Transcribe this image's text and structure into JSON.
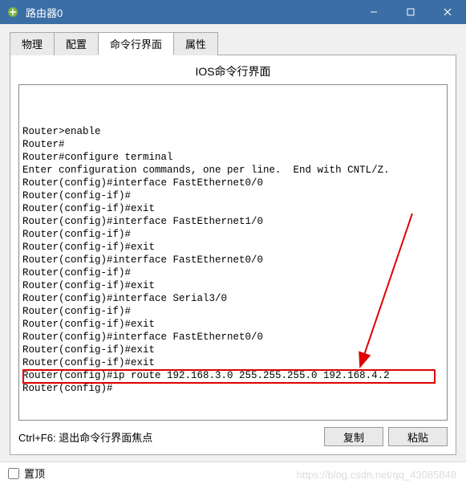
{
  "titlebar": {
    "title": "路由器0"
  },
  "tabs": {
    "items": [
      {
        "label": "物理"
      },
      {
        "label": "配置"
      },
      {
        "label": "命令行界面"
      },
      {
        "label": "属性"
      }
    ],
    "active_index": 2
  },
  "pane": {
    "title": "IOS命令行界面"
  },
  "terminal": {
    "lines": [
      "",
      "",
      "",
      "Router>enable",
      "Router#",
      "Router#configure terminal",
      "Enter configuration commands, one per line.  End with CNTL/Z.",
      "Router(config)#interface FastEthernet0/0",
      "Router(config-if)#",
      "Router(config-if)#exit",
      "Router(config)#interface FastEthernet1/0",
      "Router(config-if)#",
      "Router(config-if)#exit",
      "Router(config)#interface FastEthernet0/0",
      "Router(config-if)#",
      "Router(config-if)#exit",
      "Router(config)#interface Serial3/0",
      "Router(config-if)#",
      "Router(config-if)#exit",
      "Router(config)#interface FastEthernet0/0",
      "Router(config-if)#exit",
      "Router(config-if)#exit",
      "Router(config)#ip route 192.168.3.0 255.255.255.0 192.168.4.2",
      "Router(config)#"
    ],
    "highlighted_line_index": 22
  },
  "hint": {
    "text": "Ctrl+F6: 退出命令行界面焦点"
  },
  "buttons": {
    "copy": "复制",
    "paste": "粘贴"
  },
  "bottom": {
    "pin_label": "置顶"
  },
  "watermark": {
    "text": "https://blog.csdn.net/qq_43085848"
  }
}
